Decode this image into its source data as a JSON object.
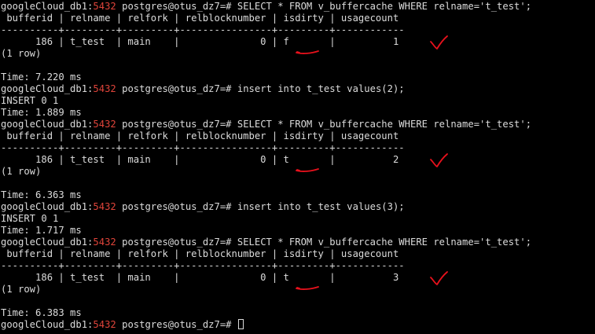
{
  "colors": {
    "background": "#000000",
    "text": "#dcdcdc",
    "port": "#e0443a",
    "annotation": "#e8111c"
  },
  "lines": [
    {
      "type": "prompt",
      "host": "googleCloud_db1:",
      "port": "5432",
      "rest": " postgres@otus_dz7=# SELECT * FROM v_buffercache WHERE relname='t_test';"
    },
    {
      "type": "text",
      "text": " bufferid | relname | relfork | relblocknumber | isdirty | usagecount"
    },
    {
      "type": "text",
      "text": "----------+---------+---------+----------------+---------+------------"
    },
    {
      "type": "text",
      "text": "      186 | t_test  | main    |              0 | f       |          1"
    },
    {
      "type": "text",
      "text": "(1 row)"
    },
    {
      "type": "text",
      "text": ""
    },
    {
      "type": "text",
      "text": "Time: 7.220 ms"
    },
    {
      "type": "prompt",
      "host": "googleCloud_db1:",
      "port": "5432",
      "rest": " postgres@otus_dz7=# insert into t_test values(2);"
    },
    {
      "type": "text",
      "text": "INSERT 0 1"
    },
    {
      "type": "text",
      "text": "Time: 1.889 ms"
    },
    {
      "type": "prompt",
      "host": "googleCloud_db1:",
      "port": "5432",
      "rest": " postgres@otus_dz7=# SELECT * FROM v_buffercache WHERE relname='t_test';"
    },
    {
      "type": "text",
      "text": " bufferid | relname | relfork | relblocknumber | isdirty | usagecount"
    },
    {
      "type": "text",
      "text": "----------+---------+---------+----------------+---------+------------"
    },
    {
      "type": "text",
      "text": "      186 | t_test  | main    |              0 | t       |          2"
    },
    {
      "type": "text",
      "text": "(1 row)"
    },
    {
      "type": "text",
      "text": ""
    },
    {
      "type": "text",
      "text": "Time: 6.363 ms"
    },
    {
      "type": "prompt",
      "host": "googleCloud_db1:",
      "port": "5432",
      "rest": " postgres@otus_dz7=# insert into t_test values(3);"
    },
    {
      "type": "text",
      "text": "INSERT 0 1"
    },
    {
      "type": "text",
      "text": "Time: 1.717 ms"
    },
    {
      "type": "prompt",
      "host": "googleCloud_db1:",
      "port": "5432",
      "rest": " postgres@otus_dz7=# SELECT * FROM v_buffercache WHERE relname='t_test';"
    },
    {
      "type": "text",
      "text": " bufferid | relname | relfork | relblocknumber | isdirty | usagecount"
    },
    {
      "type": "text",
      "text": "----------+---------+---------+----------------+---------+------------"
    },
    {
      "type": "text",
      "text": "      186 | t_test  | main    |              0 | t       |          3"
    },
    {
      "type": "text",
      "text": "(1 row)"
    },
    {
      "type": "text",
      "text": ""
    },
    {
      "type": "text",
      "text": "Time: 6.383 ms"
    },
    {
      "type": "prompt",
      "host": "googleCloud_db1:",
      "port": "5432",
      "rest": " postgres@otus_dz7=# ",
      "cursor": true
    }
  ],
  "annotations": [
    {
      "kind": "underline",
      "row": 3
    },
    {
      "kind": "checkmark",
      "row": 3
    },
    {
      "kind": "underline",
      "row": 13
    },
    {
      "kind": "checkmark",
      "row": 13
    },
    {
      "kind": "underline",
      "row": 23
    },
    {
      "kind": "checkmark",
      "row": 23
    }
  ]
}
